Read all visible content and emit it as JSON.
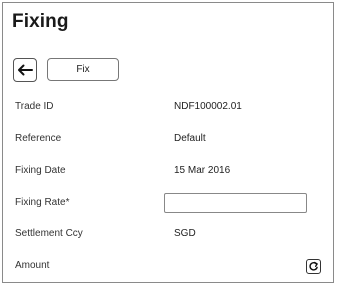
{
  "page": {
    "title": "Fixing"
  },
  "toolbar": {
    "back_icon": "arrow-left-icon",
    "fix_label": "Fix"
  },
  "fields": {
    "trade_id": {
      "label": "Trade ID",
      "value": "NDF100002.01"
    },
    "reference": {
      "label": "Reference",
      "value": "Default"
    },
    "fixing_date": {
      "label": "Fixing Date",
      "value": "15 Mar 2016"
    },
    "fixing_rate": {
      "label": "Fixing Rate*",
      "value": "",
      "placeholder": ""
    },
    "settlement_ccy": {
      "label": "Settlement Ccy",
      "value": "SGD"
    },
    "amount": {
      "label": "Amount",
      "action_icon": "refresh-icon"
    }
  }
}
